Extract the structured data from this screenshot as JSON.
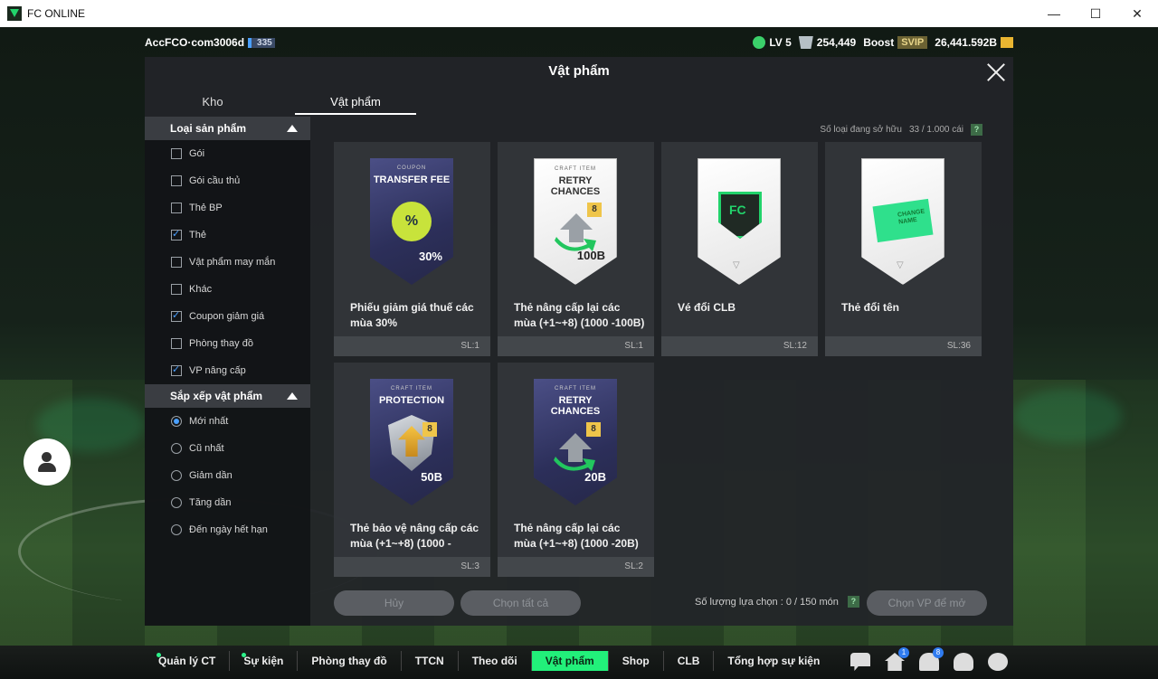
{
  "window": {
    "title": "FC ONLINE",
    "minimize": "—",
    "maximize": "☐",
    "close": "✕"
  },
  "topbar": {
    "account_name": "AccFCO·com3006d",
    "account_level": "335",
    "lv": "LV 5",
    "coins": "254,449",
    "boost_label": "Boost",
    "svip": "SVIP",
    "bp": "26,441.592B"
  },
  "modal": {
    "title": "Vật phẩm",
    "tabs": [
      {
        "label": "Kho"
      },
      {
        "label": "Vật phẩm"
      }
    ],
    "owned_label": "Số loại đang sở hữu",
    "owned_value": "33 / 1.000 cái",
    "help": "?"
  },
  "sidebar": {
    "category_head": "Loại sản phẩm",
    "categories": [
      {
        "label": "Gói",
        "checked": false
      },
      {
        "label": "Gói cầu thủ",
        "checked": false
      },
      {
        "label": "Thẻ BP",
        "checked": false
      },
      {
        "label": "Thẻ",
        "checked": true
      },
      {
        "label": "Vật phẩm may mắn",
        "checked": false
      },
      {
        "label": "Khác",
        "checked": false
      },
      {
        "label": "Coupon giảm giá",
        "checked": true
      },
      {
        "label": "Phòng thay đồ",
        "checked": false
      },
      {
        "label": "VP nâng cấp",
        "checked": true
      }
    ],
    "sort_head": "Sắp xếp vật phẩm",
    "sorts": [
      {
        "label": "Mới nhất",
        "checked": true
      },
      {
        "label": "Cũ nhất",
        "checked": false
      },
      {
        "label": "Giảm dần",
        "checked": false
      },
      {
        "label": "Tăng dần",
        "checked": false
      },
      {
        "label": "Đến ngày hết hạn",
        "checked": false
      }
    ]
  },
  "items": [
    {
      "name": "Phiếu giảm giá thuế các mùa 30%",
      "qty": "SL:1",
      "card_small": "COUPON",
      "card_label": "TRANSFER FEE",
      "card_num": "30%",
      "seal": "%"
    },
    {
      "name": "Thẻ nâng cấp lại các mùa (+1~+8) (1000 -100B)",
      "qty": "SL:1",
      "card_small": "CRAFT ITEM",
      "card_label": "RETRY CHANCES",
      "card_num": "100B",
      "badge": "8"
    },
    {
      "name": "Vé đổi CLB",
      "qty": "SL:12",
      "card_logo": "FC"
    },
    {
      "name": "Thẻ đổi tên",
      "qty": "SL:36",
      "card_ticket": "CHANGE NAME"
    },
    {
      "name": "Thẻ bảo vệ nâng cấp các mùa (+1~+8) (1000 -",
      "qty": "SL:3",
      "card_small": "CRAFT ITEM",
      "card_label": "PROTECTION",
      "card_num": "50B",
      "badge": "8"
    },
    {
      "name": "Thẻ nâng cấp lại các mùa (+1~+8) (1000 -20B)",
      "qty": "SL:2",
      "card_small": "CRAFT ITEM",
      "card_label": "RETRY CHANCES",
      "card_num": "20B",
      "badge": "8"
    }
  ],
  "footer": {
    "cancel": "Hủy",
    "select_all": "Chọn tất cả",
    "select_count_label": "Số lượng lựa chọn : 0 / 150 món",
    "open": "Chọn VP để mở",
    "help": "?"
  },
  "nav": [
    {
      "label": "Quản lý CT",
      "dot": true
    },
    {
      "label": "Sự kiện",
      "dot": true
    },
    {
      "label": "Phòng thay đồ",
      "dot": false
    },
    {
      "label": "TTCN",
      "dot": false
    },
    {
      "label": "Theo dõi",
      "dot": false
    },
    {
      "label": "Vật phẩm",
      "dot": false,
      "active": true
    },
    {
      "label": "Shop",
      "dot": false
    },
    {
      "label": "CLB",
      "dot": false
    },
    {
      "label": "Tổng hợp sự kiện",
      "dot": false
    }
  ],
  "nav_icons": [
    {
      "name": "chat-icon"
    },
    {
      "name": "home-icon",
      "badge": "1"
    },
    {
      "name": "bell-icon",
      "badge": "8"
    },
    {
      "name": "user-icon"
    },
    {
      "name": "gear-icon"
    }
  ]
}
